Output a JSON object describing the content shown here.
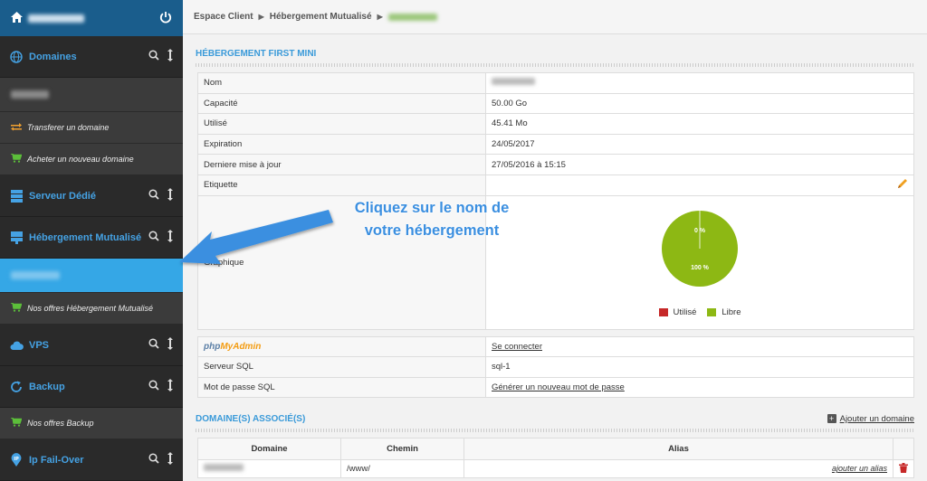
{
  "sidebar": {
    "domains": {
      "label": "Domaines"
    },
    "transfer": "Transferer un domaine",
    "buy": "Acheter un nouveau domaine",
    "dedicated": {
      "label": "Serveur Dédié"
    },
    "shared": {
      "label": "Hébergement Mutualisé"
    },
    "shared_offers": "Nos offres Hébergement Mutualisé",
    "vps": {
      "label": "VPS"
    },
    "backup": {
      "label": "Backup"
    },
    "backup_offers": "Nos offres Backup",
    "ipfo": {
      "label": "Ip Fail-Over"
    }
  },
  "breadcrumb": [
    "Espace Client",
    "Hébergement Mutualisé"
  ],
  "hosting": {
    "title": "HÉBERGEMENT FIRST MINI",
    "rows": {
      "name": {
        "key": "Nom",
        "value": ""
      },
      "capacity": {
        "key": "Capacité",
        "value": "50.00 Go"
      },
      "used": {
        "key": "Utilisé",
        "value": "45.41 Mo"
      },
      "expiration": {
        "key": "Expiration",
        "value": "24/05/2017"
      },
      "updated": {
        "key": "Derniere mise à jour",
        "value": "27/05/2016 à 15:15"
      },
      "label": {
        "key": "Etiquette",
        "value": ""
      },
      "graph": {
        "key": "Graphique"
      }
    },
    "chart": {
      "used_label": "0 %",
      "free_label": "100 %",
      "legend_used": "Utilisé",
      "legend_free": "Libre",
      "color_used": "#c62828",
      "color_free": "#8db814"
    }
  },
  "chart_data": {
    "type": "pie",
    "categories": [
      "Utilisé",
      "Libre"
    ],
    "values": [
      0,
      100
    ],
    "colors": [
      "#c62828",
      "#8db814"
    ]
  },
  "sql": {
    "pma_p": "php",
    "pma_m": "MyAdmin",
    "connect": "Se connecter",
    "server_key": "Serveur SQL",
    "server_value": "sql-1",
    "pwd_key": "Mot de passe SQL",
    "pwd_value": "Générer un nouveau mot de passe"
  },
  "domains_assoc": {
    "title": "DOMAINE(S) ASSOCIÉ(S)",
    "add": "Ajouter un domaine",
    "headers": [
      "Domaine",
      "Chemin",
      "Alias"
    ],
    "row": {
      "path": "/www/",
      "alias": "ajouter un alias"
    }
  },
  "callout": {
    "line1": "Cliquez sur le nom de",
    "line2": "votre hébergement"
  }
}
